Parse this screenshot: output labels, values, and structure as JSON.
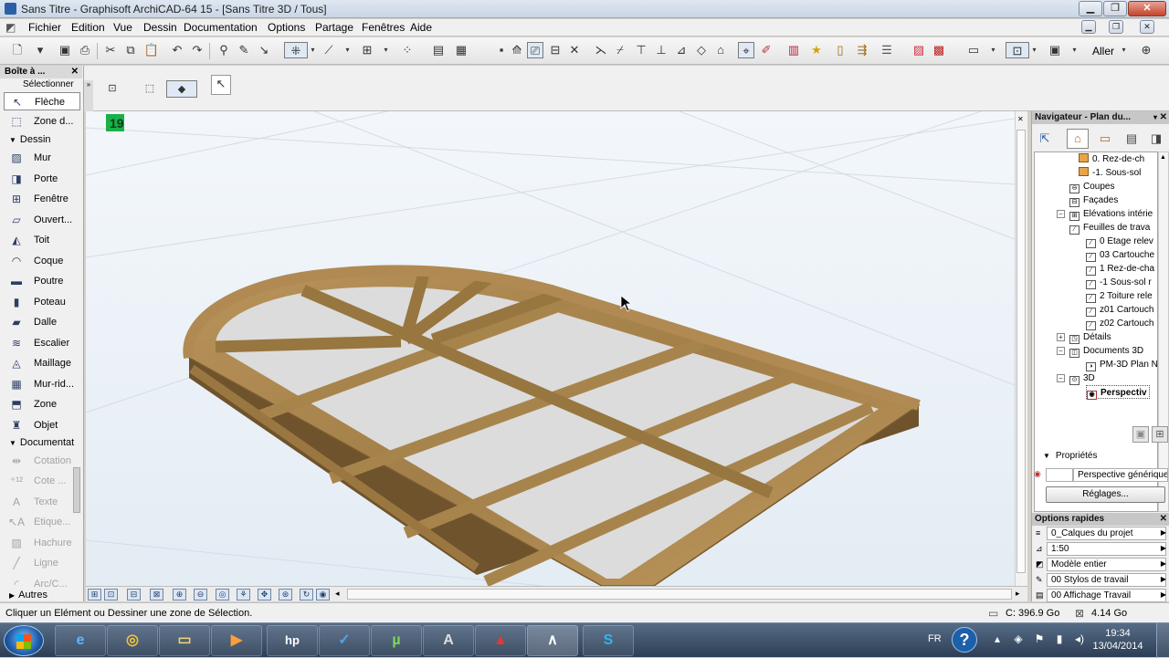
{
  "window": {
    "title": "Sans Titre - Graphisoft ArchiCAD-64 15 - [Sans Titre 3D / Tous]",
    "controls": [
      "minimize",
      "maximize",
      "close"
    ]
  },
  "menu": [
    "Fichier",
    "Edition",
    "Vue",
    "Dessin",
    "Documentation",
    "Options",
    "Partage",
    "Fenêtres",
    "Aide"
  ],
  "toolbar": {
    "goto_label": "Aller",
    "icons": [
      "new-icon",
      "open-icon",
      "save-icon",
      "print-icon",
      "cut-icon",
      "copy-icon",
      "paste-icon",
      "undo-icon",
      "redo-icon",
      "magic-wand-icon",
      "eyedropper-icon",
      "cursor-snap-icon",
      "guide-line-icon",
      "snap-icon",
      "grid-icon",
      "layer-icon",
      "pencil-icon",
      "trace-icon",
      "ruler-icon",
      "navigate-icon",
      "star-icon",
      "book-icon",
      "publisher-icon",
      "teamwork-icon"
    ]
  },
  "toolbox": {
    "header": "Boîte à ...",
    "select_label": "Sélectionner",
    "arrow": "Flèche",
    "marquee": "Zone d...",
    "design_section": "Dessin",
    "design_tools": [
      {
        "label": "Mur",
        "icon": "wall-icon"
      },
      {
        "label": "Porte",
        "icon": "door-icon"
      },
      {
        "label": "Fenêtre",
        "icon": "window-icon"
      },
      {
        "label": "Ouvert...",
        "icon": "opening-icon"
      },
      {
        "label": "Toit",
        "icon": "roof-icon"
      },
      {
        "label": "Coque",
        "icon": "shell-icon"
      },
      {
        "label": "Poutre",
        "icon": "beam-icon"
      },
      {
        "label": "Poteau",
        "icon": "column-icon"
      },
      {
        "label": "Dalle",
        "icon": "slab-icon"
      },
      {
        "label": "Escalier",
        "icon": "stair-icon"
      },
      {
        "label": "Maillage",
        "icon": "mesh-icon"
      },
      {
        "label": "Mur-rid...",
        "icon": "curtain-wall-icon"
      },
      {
        "label": "Zone",
        "icon": "zone-icon"
      },
      {
        "label": "Objet",
        "icon": "object-icon"
      }
    ],
    "doc_section": "Documentat",
    "doc_tools": [
      {
        "label": "Cotation",
        "icon": "dimension-icon"
      },
      {
        "label": "Cote ...",
        "icon": "level-dimension-icon"
      },
      {
        "label": "Texte",
        "icon": "text-icon"
      },
      {
        "label": "Etique...",
        "icon": "label-icon"
      },
      {
        "label": "Hachure",
        "icon": "fill-icon"
      },
      {
        "label": "Ligne",
        "icon": "line-icon"
      },
      {
        "label": "Arc/C...",
        "icon": "arc-icon"
      }
    ],
    "other_section": "Autres"
  },
  "viewport": {
    "badge": "19",
    "wood_colors": {
      "light": "#b08a52",
      "dark": "#6e532c",
      "top": "#a6844e",
      "glass": "#d9d9d9"
    }
  },
  "navigator": {
    "title": "Navigateur - Plan du...",
    "tree": [
      {
        "label": "0. Rez-de-ch",
        "level": 3,
        "icon": "folder-icon"
      },
      {
        "label": "-1. Sous-sol",
        "level": 3,
        "icon": "folder-icon"
      },
      {
        "label": "Coupes",
        "level": 2,
        "icon": "section-icon"
      },
      {
        "label": "Façades",
        "level": 2,
        "icon": "elevation-icon"
      },
      {
        "label": "Elévations intérie",
        "level": 2,
        "icon": "interior-elevation-icon"
      },
      {
        "label": "Feuilles de trava",
        "level": 2,
        "icon": "worksheet-icon"
      },
      {
        "label": "0 Etage relev",
        "level": 3,
        "icon": "worksheet-item-icon"
      },
      {
        "label": "03 Cartouche",
        "level": 3,
        "icon": "worksheet-item-icon"
      },
      {
        "label": "1 Rez-de-cha",
        "level": 3,
        "icon": "worksheet-item-icon"
      },
      {
        "label": "-1 Sous-sol r",
        "level": 3,
        "icon": "worksheet-item-icon"
      },
      {
        "label": "2 Toiture rele",
        "level": 3,
        "icon": "worksheet-item-icon"
      },
      {
        "label": "z01 Cartouch",
        "level": 3,
        "icon": "worksheet-item-icon"
      },
      {
        "label": "z02 Cartouch",
        "level": 3,
        "icon": "worksheet-item-icon"
      },
      {
        "label": "Détails",
        "level": 2,
        "icon": "detail-icon"
      },
      {
        "label": "Documents 3D",
        "level": 2,
        "icon": "document-3d-icon"
      },
      {
        "label": "PM-3D Plan N",
        "level": 3,
        "icon": "document-3d-item-icon"
      },
      {
        "label": "3D",
        "level": 2,
        "icon": "3d-icon"
      },
      {
        "label": "Perspectiv",
        "level": 3,
        "icon": "perspective-icon",
        "selected": true
      }
    ],
    "properties_label": "Propriétés",
    "properties_value": "Perspective générique",
    "settings_button": "Réglages..."
  },
  "quick_options": {
    "title": "Options rapides",
    "rows": [
      {
        "value": "0_Calques du projet",
        "icon": "layers-icon"
      },
      {
        "value": "1:50",
        "icon": "scale-icon"
      },
      {
        "value": "Modèle entier",
        "icon": "model-view-icon"
      },
      {
        "value": "00 Stylos de travail",
        "icon": "pen-set-icon"
      },
      {
        "value": "00 Affichage Travail",
        "icon": "view-mode-icon"
      }
    ]
  },
  "status": {
    "message": "Cliquer un Elément ou Dessiner une zone de Sélection.",
    "disk": "C: 396.9 Go",
    "memory": "4.14 Go"
  },
  "taskbar": {
    "apps": [
      {
        "name": "internet-explorer-icon",
        "glyph": "e"
      },
      {
        "name": "chrome-icon",
        "glyph": "◎"
      },
      {
        "name": "explorer-icon",
        "glyph": "▭"
      },
      {
        "name": "media-player-icon",
        "glyph": "▶"
      },
      {
        "name": "hp-icon",
        "glyph": "hp"
      },
      {
        "name": "task-app-icon",
        "glyph": "✓"
      },
      {
        "name": "utorrent-icon",
        "glyph": "µ"
      },
      {
        "name": "archicad-icon",
        "glyph": "A"
      },
      {
        "name": "autocad-icon",
        "glyph": "▲"
      },
      {
        "name": "archicad-window-icon",
        "glyph": "∧"
      },
      {
        "name": "skype-icon",
        "glyph": "S"
      }
    ],
    "lang": "FR",
    "time": "19:34",
    "date": "13/04/2014"
  }
}
